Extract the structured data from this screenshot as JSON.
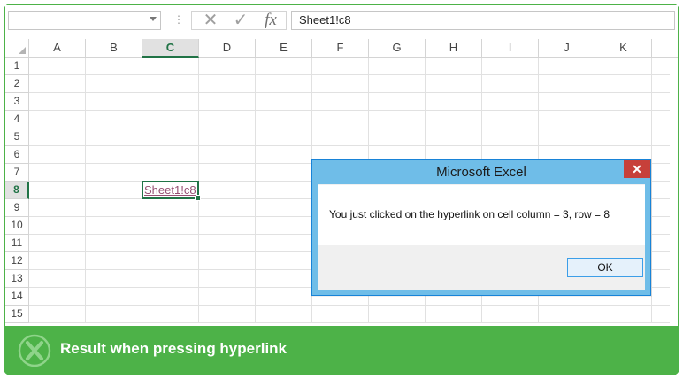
{
  "formula_bar": {
    "name_box_value": "",
    "separator": "⋮",
    "cancel_glyph": "✕",
    "enter_glyph": "✓",
    "function_glyph": "fx",
    "formula_value": "Sheet1!c8"
  },
  "sheet": {
    "columns": [
      "A",
      "B",
      "C",
      "D",
      "E",
      "F",
      "G",
      "H",
      "I",
      "J",
      "K"
    ],
    "rows": [
      "1",
      "2",
      "3",
      "4",
      "5",
      "6",
      "7",
      "8",
      "9",
      "10",
      "11",
      "12",
      "13",
      "14",
      "15"
    ],
    "selected_column": "C",
    "selected_row": "8",
    "active_cell_text": "Sheet1!c8"
  },
  "dialog": {
    "title": "Microsoft Excel",
    "close_glyph": "✕",
    "message": "You just clicked on the hyperlink on cell column = 3, row = 8",
    "ok_label": "OK"
  },
  "banner": {
    "caption": "Result when pressing hyperlink"
  },
  "colors": {
    "brand_green": "#4db248",
    "excel_green": "#217346",
    "hyperlink_visited": "#954f72",
    "dialog_border": "#6fbde8",
    "close_red": "#c7403a"
  }
}
